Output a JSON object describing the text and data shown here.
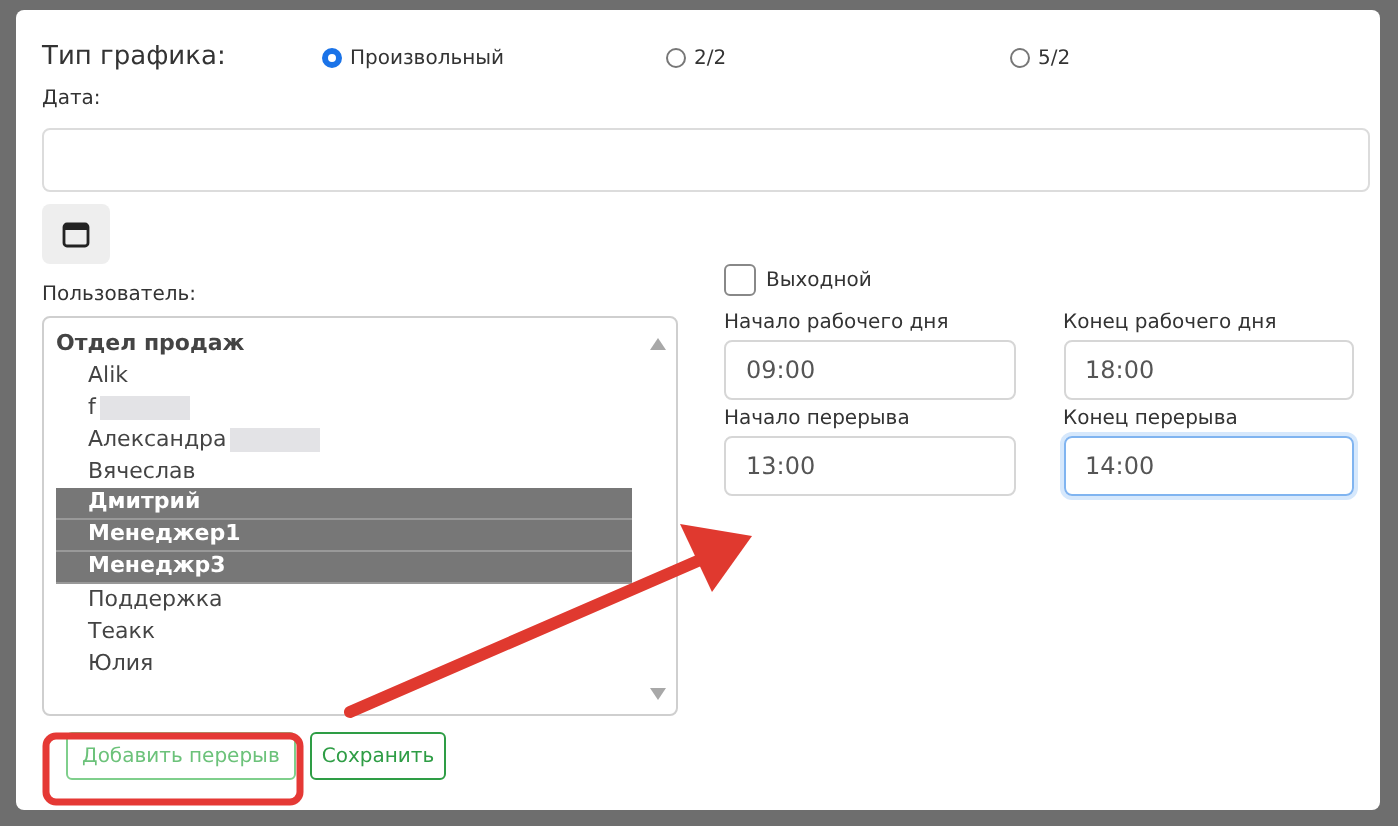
{
  "schedule_type": {
    "label": "Тип графика:",
    "options": [
      {
        "label": "Произвольный",
        "selected": true
      },
      {
        "label": "2/2",
        "selected": false
      },
      {
        "label": "5/2",
        "selected": false
      }
    ]
  },
  "date": {
    "label": "Дата:"
  },
  "user": {
    "label": "Пользователь:",
    "group": "Отдел продаж",
    "items": [
      {
        "label": "Alik",
        "selected": false,
        "redacted": false
      },
      {
        "label": "f",
        "selected": false,
        "redacted": true
      },
      {
        "label": "Александра",
        "selected": false,
        "redacted": true
      },
      {
        "label": "Вячеслав",
        "selected": false,
        "redacted": false
      },
      {
        "label": "Дмитрий",
        "selected": true,
        "redacted": false
      },
      {
        "label": "Менеджер1",
        "selected": true,
        "redacted": false
      },
      {
        "label": "Менеджр3",
        "selected": true,
        "redacted": false
      },
      {
        "label": "Поддержка",
        "selected": false,
        "redacted": false
      },
      {
        "label": "Теакк",
        "selected": false,
        "redacted": false
      },
      {
        "label": "Юлия",
        "selected": false,
        "redacted": false
      }
    ]
  },
  "day_off": {
    "label": "Выходной",
    "checked": false
  },
  "times": [
    {
      "label": "Начало рабочего дня",
      "value": "09:00",
      "focused": false
    },
    {
      "label": "Конец рабочего дня",
      "value": "18:00",
      "focused": false
    },
    {
      "label": "Начало перерыва",
      "value": "13:00",
      "focused": false
    },
    {
      "label": "Конец перерыва",
      "value": "14:00",
      "focused": true
    }
  ],
  "buttons": [
    {
      "label": "Добавить перерыв",
      "highlighted": true
    },
    {
      "label": "Сохранить",
      "highlighted": false
    }
  ]
}
